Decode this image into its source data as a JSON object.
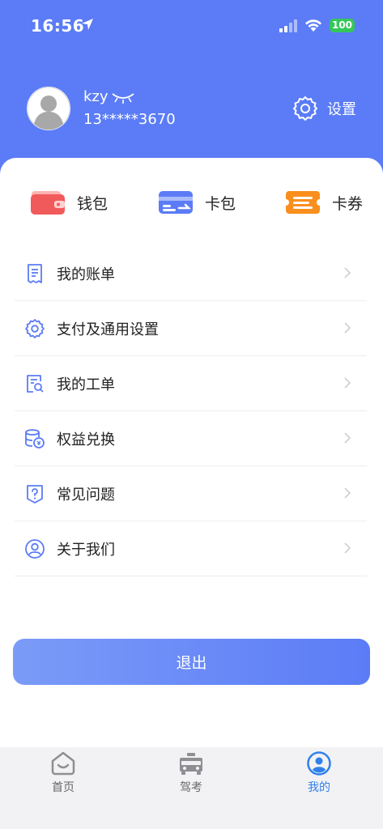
{
  "status": {
    "time": "16:56",
    "battery": "100"
  },
  "profile": {
    "name": "kzy",
    "phone": "13*****3670",
    "settings_label": "设置"
  },
  "quick_actions": [
    {
      "label": "钱包"
    },
    {
      "label": "卡包"
    },
    {
      "label": "卡券"
    }
  ],
  "menu": [
    {
      "label": "我的账单"
    },
    {
      "label": "支付及通用设置"
    },
    {
      "label": "我的工单"
    },
    {
      "label": "权益兑换"
    },
    {
      "label": "常见问题"
    },
    {
      "label": "关于我们"
    }
  ],
  "logout_label": "退出",
  "tabs": [
    {
      "label": "首页"
    },
    {
      "label": "驾考"
    },
    {
      "label": "我的"
    }
  ],
  "colors": {
    "brand": "#5b7cf6",
    "tab_active": "#2f80ed",
    "battery": "#34c759"
  }
}
